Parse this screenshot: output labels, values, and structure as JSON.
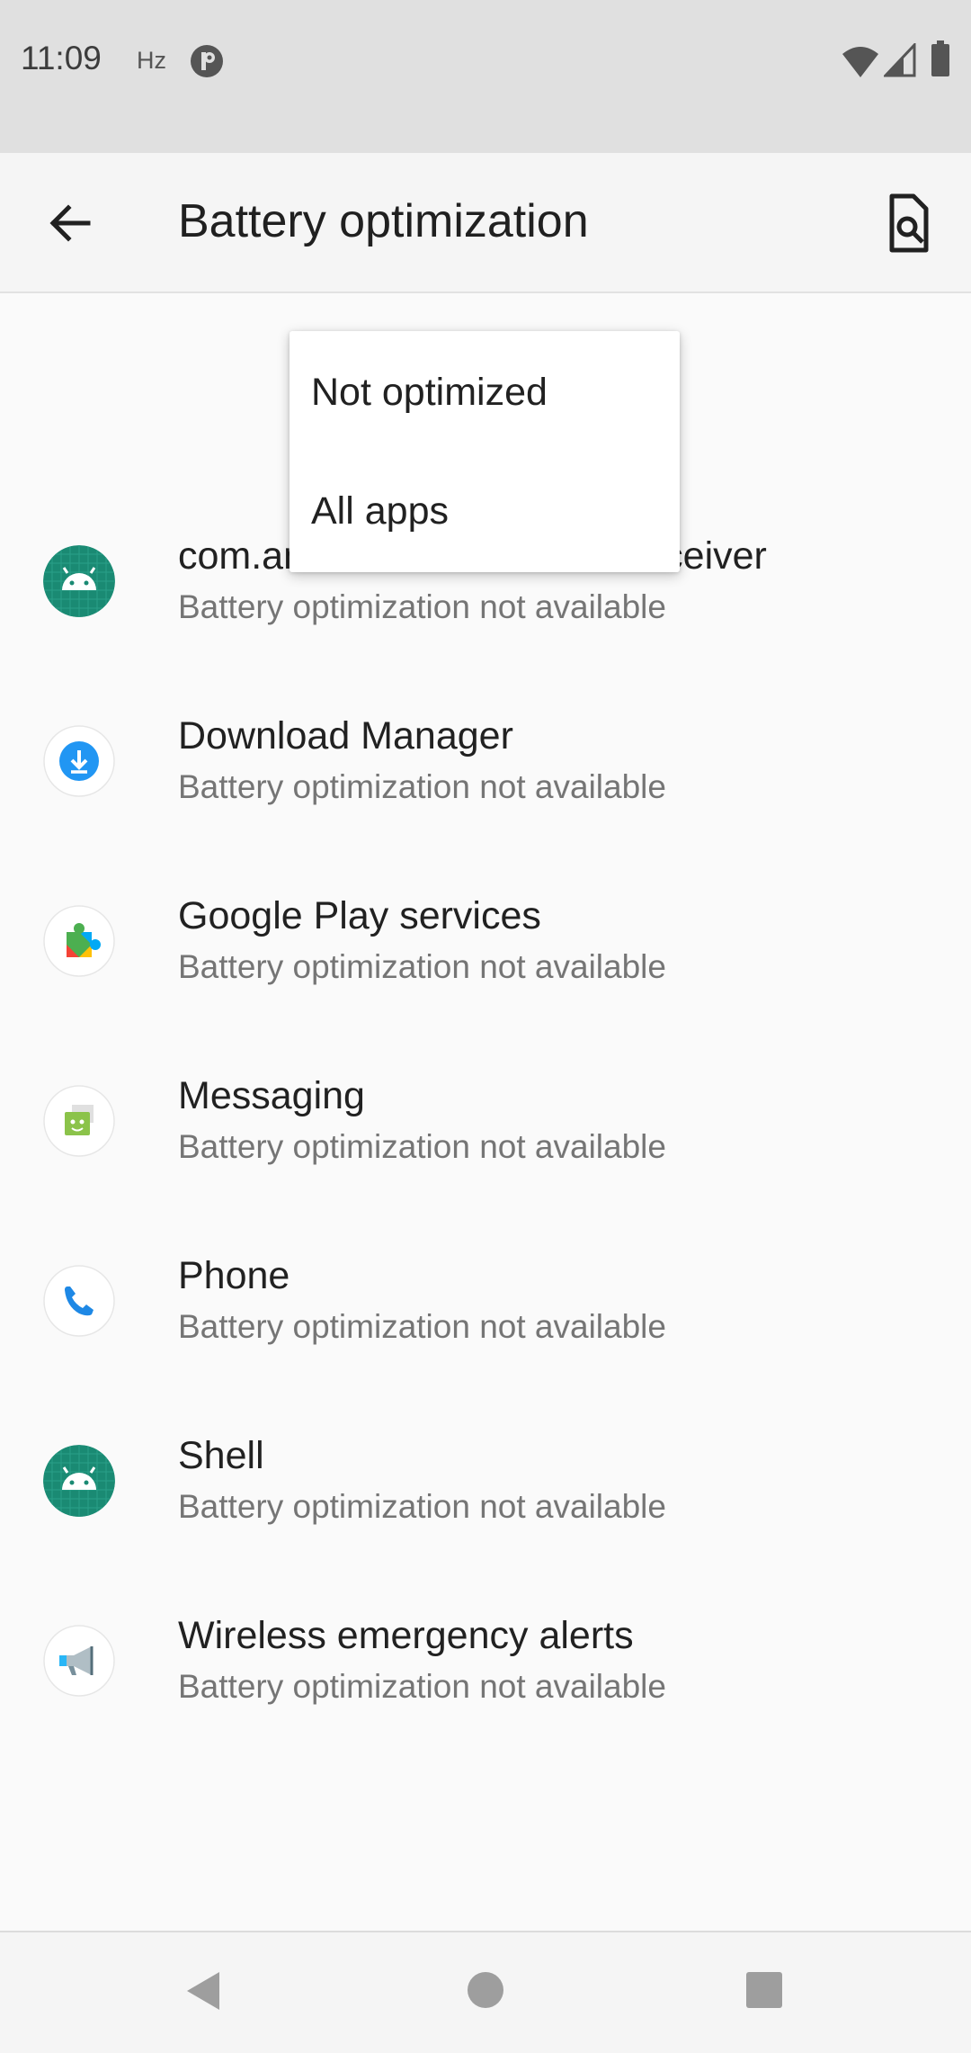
{
  "status_bar": {
    "time": "11:09",
    "hz": "Hz",
    "icons": [
      "privacy-icon",
      "wifi-icon",
      "signal-icon",
      "battery-icon"
    ]
  },
  "app_bar": {
    "title": "Battery optimization",
    "back_icon": "arrow-back-icon",
    "search_icon": "search-in-page-icon"
  },
  "dropdown": {
    "items": [
      {
        "label": "Not optimized"
      },
      {
        "label": "All apps"
      }
    ]
  },
  "apps": [
    {
      "name": "com.android.cellbroadcastreceiver",
      "status": "Battery optimization not available",
      "icon": "android-icon"
    },
    {
      "name": "Download Manager",
      "status": "Battery optimization not available",
      "icon": "download-icon"
    },
    {
      "name": "Google Play services",
      "status": "Battery optimization not available",
      "icon": "play-services-icon"
    },
    {
      "name": "Messaging",
      "status": "Battery optimization not available",
      "icon": "messaging-icon"
    },
    {
      "name": "Phone",
      "status": "Battery optimization not available",
      "icon": "phone-icon"
    },
    {
      "name": "Shell",
      "status": "Battery optimization not available",
      "icon": "android-icon"
    },
    {
      "name": "Wireless emergency alerts",
      "status": "Battery optimization not available",
      "icon": "megaphone-icon"
    }
  ],
  "nav_bar": {
    "icons": [
      "nav-back-icon",
      "nav-home-icon",
      "nav-recents-icon"
    ]
  },
  "colors": {
    "android_green": "#1a8a73",
    "download_blue": "#2196f3",
    "phone_blue": "#1e88e5",
    "messaging_green": "#8bc34a"
  }
}
